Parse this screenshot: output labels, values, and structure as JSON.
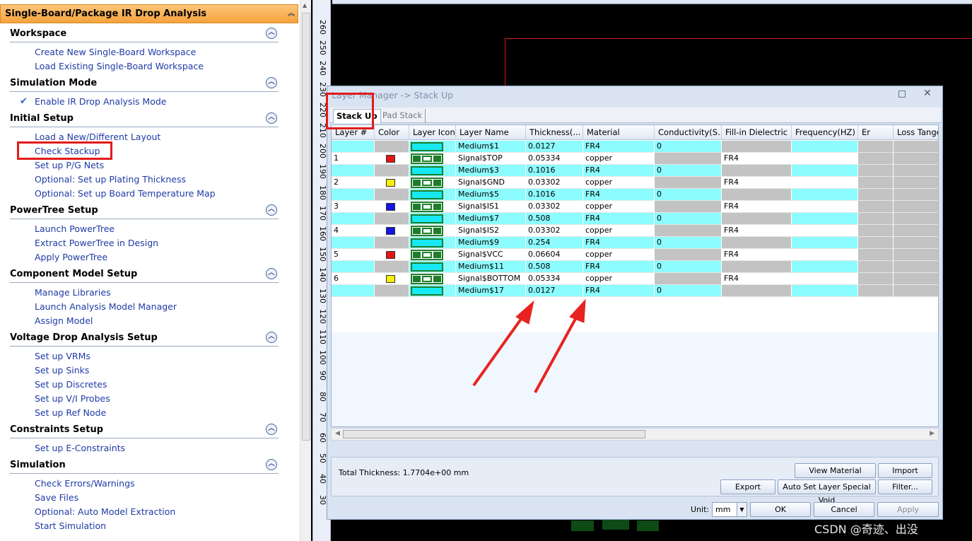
{
  "left_panel": {
    "title": "Single-Board/Package IR Drop Analysis",
    "sections": [
      {
        "title": "Workspace",
        "items": [
          "Create New Single-Board Workspace",
          "Load Existing Single-Board Workspace"
        ]
      },
      {
        "title": "Simulation Mode",
        "items": [
          "Enable IR Drop Analysis Mode"
        ]
      },
      {
        "title": "Initial Setup",
        "items": [
          "Load a New/Different Layout",
          "Check Stackup",
          "Set up P/G Nets",
          "Optional: Set up Plating Thickness",
          "Optional: Set up Board Temperature Map"
        ]
      },
      {
        "title": "PowerTree Setup",
        "items": [
          "Launch PowerTree",
          "Extract PowerTree in Design",
          "Apply PowerTree"
        ]
      },
      {
        "title": "Component Model Setup",
        "items": [
          "Manage Libraries",
          "Launch Analysis Model Manager",
          "Assign Model"
        ]
      },
      {
        "title": "Voltage Drop Analysis Setup",
        "items": [
          "Set up VRMs",
          "Set up Sinks",
          "Set up Discretes",
          "Set up V/I Probes",
          "Set up Ref Node"
        ]
      },
      {
        "title": "Constraints Setup",
        "items": [
          "Set up E-Constraints"
        ]
      },
      {
        "title": "Simulation",
        "items": [
          "Check Errors/Warnings",
          "Save Files",
          "Optional: Auto Model Extraction",
          "Start Simulation"
        ]
      }
    ]
  },
  "ruler": {
    "ticks": [
      "260",
      "250",
      "240",
      "230",
      "220",
      "210",
      "200",
      "190",
      "180",
      "170",
      "160",
      "150",
      "140",
      "130",
      "120",
      "110",
      "100",
      "90",
      "80",
      "70",
      "60",
      "50",
      "40",
      "30"
    ]
  },
  "dialog": {
    "title": "Layer Manager -> Stack Up",
    "tabs": {
      "stack_up": "Stack Up",
      "pad_stack": "Pad Stack"
    },
    "columns": [
      "Layer #",
      "Color",
      "Layer Icon",
      "Layer Name",
      "Thickness(...",
      "Material",
      "Conductivity(S...",
      "Fill-in Dielectric",
      "Frequency(HZ)",
      "Er",
      "Loss Tange"
    ],
    "rows": [
      {
        "type": "medium",
        "layer_no": "",
        "color": "",
        "name": "Medium$1",
        "thickness": "0.0127",
        "material": "FR4",
        "conductivity": "0",
        "fill": ""
      },
      {
        "type": "signal",
        "layer_no": "1",
        "color": "#e31414",
        "name": "Signal$TOP",
        "thickness": "0.05334",
        "material": "copper",
        "conductivity": "",
        "fill": "FR4"
      },
      {
        "type": "medium",
        "layer_no": "",
        "color": "",
        "name": "Medium$3",
        "thickness": "0.1016",
        "material": "FR4",
        "conductivity": "0",
        "fill": ""
      },
      {
        "type": "signal",
        "layer_no": "2",
        "color": "#f5ef08",
        "name": "Signal$GND",
        "thickness": "0.03302",
        "material": "copper",
        "conductivity": "",
        "fill": "FR4"
      },
      {
        "type": "medium",
        "layer_no": "",
        "color": "",
        "name": "Medium$5",
        "thickness": "0.1016",
        "material": "FR4",
        "conductivity": "0",
        "fill": ""
      },
      {
        "type": "signal",
        "layer_no": "3",
        "color": "#1414e3",
        "name": "Signal$IS1",
        "thickness": "0.03302",
        "material": "copper",
        "conductivity": "",
        "fill": "FR4"
      },
      {
        "type": "medium",
        "layer_no": "",
        "color": "",
        "name": "Medium$7",
        "thickness": "0.508",
        "material": "FR4",
        "conductivity": "0",
        "fill": ""
      },
      {
        "type": "signal",
        "layer_no": "4",
        "color": "#1414e3",
        "name": "Signal$IS2",
        "thickness": "0.03302",
        "material": "copper",
        "conductivity": "",
        "fill": "FR4"
      },
      {
        "type": "medium",
        "layer_no": "",
        "color": "",
        "name": "Medium$9",
        "thickness": "0.254",
        "material": "FR4",
        "conductivity": "0",
        "fill": ""
      },
      {
        "type": "signal",
        "layer_no": "5",
        "color": "#e31414",
        "name": "Signal$VCC",
        "thickness": "0.06604",
        "material": "copper",
        "conductivity": "",
        "fill": "FR4"
      },
      {
        "type": "medium",
        "layer_no": "",
        "color": "",
        "name": "Medium$11",
        "thickness": "0.508",
        "material": "FR4",
        "conductivity": "0",
        "fill": ""
      },
      {
        "type": "signal",
        "layer_no": "6",
        "color": "#f5ef08",
        "name": "Signal$BOTTOM",
        "thickness": "0.05334",
        "material": "copper",
        "conductivity": "",
        "fill": "FR4"
      },
      {
        "type": "medium",
        "layer_no": "",
        "color": "",
        "name": "Medium$17",
        "thickness": "0.0127",
        "material": "FR4",
        "conductivity": "0",
        "fill": ""
      }
    ],
    "total_thickness": "Total Thickness:  1.7704e+00 mm",
    "buttons": {
      "view_material": "View Material",
      "import": "Import",
      "export": "Export",
      "auto_set": "Auto Set Layer Special Void",
      "filter": "Filter...",
      "ok": "OK",
      "cancel": "Cancel",
      "apply": "Apply"
    },
    "unit_label": "Unit:",
    "unit_value": "mm"
  },
  "watermark": "CSDN @奇迹、出没"
}
